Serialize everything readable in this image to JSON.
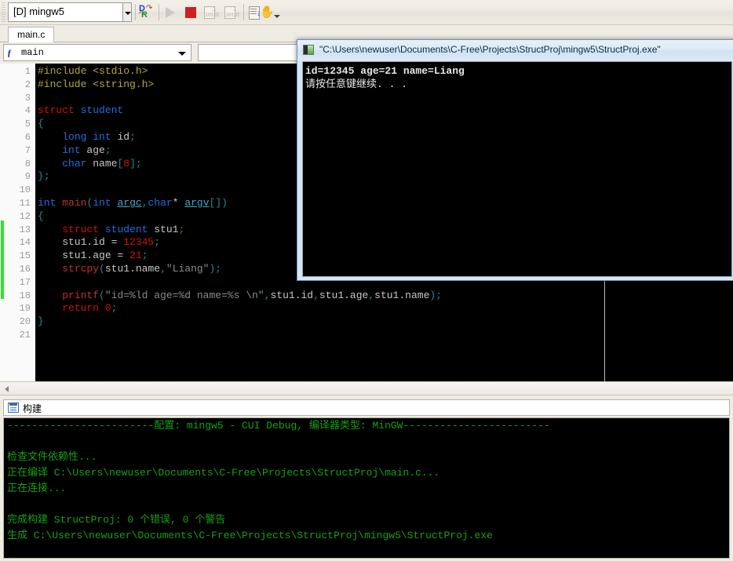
{
  "toolbar": {
    "target_combo_value": "[D] mingw5",
    "buttons": [
      {
        "name": "debug-release-toggle",
        "icon": "debug-release-icon",
        "label": "Debug/Release"
      },
      {
        "name": "run-button",
        "icon": "play-icon",
        "label": "Run"
      },
      {
        "name": "stop-button",
        "icon": "stop-icon",
        "label": "Stop"
      },
      {
        "name": "step-into-button",
        "icon": "step-into-icon",
        "label": "Step Into"
      },
      {
        "name": "step-over-button",
        "icon": "step-over-icon",
        "label": "Step Over"
      },
      {
        "name": "build-log-button",
        "icon": "list-down-icon",
        "label": "Build Log"
      },
      {
        "name": "pause-hand-button",
        "icon": "hand-icon",
        "label": "Hand"
      }
    ],
    "overflow_icon": "chevron-down-icon"
  },
  "tabs": [
    {
      "label": "main.c",
      "active": true
    }
  ],
  "navbar": {
    "function_icon": "function-f-icon",
    "function_value": "main",
    "dropdown_icon": "chevron-down-icon",
    "second_field_value": ""
  },
  "editor": {
    "first_line": 1,
    "last_line": 21,
    "line_numbers": [
      "1",
      "2",
      "3",
      "4",
      "5",
      "6",
      "7",
      "8",
      "9",
      "10",
      "11",
      "12",
      "13",
      "14",
      "15",
      "16",
      "17",
      "18",
      "19",
      "20",
      "21"
    ],
    "lines": [
      {
        "n": 1,
        "tokens": [
          {
            "t": "#include <stdio.h>",
            "c": "k-pre"
          }
        ]
      },
      {
        "n": 2,
        "tokens": [
          {
            "t": "#include <string.h>",
            "c": "k-pre"
          }
        ]
      },
      {
        "n": 3,
        "tokens": []
      },
      {
        "n": 4,
        "tokens": [
          {
            "t": "struct",
            "c": "k-kw"
          },
          {
            "t": " ",
            "c": "k-plain"
          },
          {
            "t": "student",
            "c": "k-type"
          }
        ]
      },
      {
        "n": 5,
        "tokens": [
          {
            "t": "{",
            "c": "k-punc"
          }
        ]
      },
      {
        "n": 6,
        "tokens": [
          {
            "t": "    ",
            "c": "k-plain"
          },
          {
            "t": "long",
            "c": "k-type"
          },
          {
            "t": " ",
            "c": "k-plain"
          },
          {
            "t": "int",
            "c": "k-type"
          },
          {
            "t": " id",
            "c": "k-plain"
          },
          {
            "t": ";",
            "c": "k-punc"
          }
        ]
      },
      {
        "n": 7,
        "tokens": [
          {
            "t": "    ",
            "c": "k-plain"
          },
          {
            "t": "int",
            "c": "k-type"
          },
          {
            "t": " age",
            "c": "k-plain"
          },
          {
            "t": ";",
            "c": "k-punc"
          }
        ]
      },
      {
        "n": 8,
        "tokens": [
          {
            "t": "    ",
            "c": "k-plain"
          },
          {
            "t": "char",
            "c": "k-type"
          },
          {
            "t": " name",
            "c": "k-plain"
          },
          {
            "t": "[",
            "c": "k-punc"
          },
          {
            "t": "8",
            "c": "k-num"
          },
          {
            "t": "]",
            "c": "k-punc"
          },
          {
            "t": ";",
            "c": "k-punc"
          }
        ]
      },
      {
        "n": 9,
        "tokens": [
          {
            "t": "}",
            "c": "k-punc"
          },
          {
            "t": ";",
            "c": "k-punc"
          }
        ]
      },
      {
        "n": 10,
        "tokens": []
      },
      {
        "n": 11,
        "tokens": [
          {
            "t": "int",
            "c": "k-type"
          },
          {
            "t": " ",
            "c": "k-plain"
          },
          {
            "t": "main",
            "c": "k-fn"
          },
          {
            "t": "(",
            "c": "k-punc"
          },
          {
            "t": "int",
            "c": "k-type"
          },
          {
            "t": " ",
            "c": "k-plain"
          },
          {
            "t": "argc",
            "c": "k-id k-ul"
          },
          {
            "t": ",",
            "c": "k-punc"
          },
          {
            "t": "char",
            "c": "k-type"
          },
          {
            "t": "* ",
            "c": "k-plain"
          },
          {
            "t": "argv",
            "c": "k-id k-ul"
          },
          {
            "t": "[]",
            "c": "k-punc"
          },
          {
            "t": ")",
            "c": "k-punc"
          }
        ]
      },
      {
        "n": 12,
        "tokens": [
          {
            "t": "{",
            "c": "k-punc"
          }
        ]
      },
      {
        "n": 13,
        "tokens": [
          {
            "t": "    ",
            "c": "k-plain"
          },
          {
            "t": "struct",
            "c": "k-kw"
          },
          {
            "t": " ",
            "c": "k-plain"
          },
          {
            "t": "student",
            "c": "k-type"
          },
          {
            "t": " stu1",
            "c": "k-plain"
          },
          {
            "t": ";",
            "c": "k-punc"
          }
        ]
      },
      {
        "n": 14,
        "tokens": [
          {
            "t": "    stu1.id = ",
            "c": "k-plain"
          },
          {
            "t": "12345",
            "c": "k-num"
          },
          {
            "t": ";",
            "c": "k-punc"
          }
        ]
      },
      {
        "n": 15,
        "tokens": [
          {
            "t": "    stu1.age = ",
            "c": "k-plain"
          },
          {
            "t": "21",
            "c": "k-num"
          },
          {
            "t": ";",
            "c": "k-punc"
          }
        ]
      },
      {
        "n": 16,
        "tokens": [
          {
            "t": "    ",
            "c": "k-plain"
          },
          {
            "t": "strcpy",
            "c": "k-fn"
          },
          {
            "t": "(",
            "c": "k-punc"
          },
          {
            "t": "stu1.name",
            "c": "k-plain"
          },
          {
            "t": ",",
            "c": "k-punc"
          },
          {
            "t": "\"Liang\"",
            "c": "k-str"
          },
          {
            "t": ")",
            "c": "k-punc"
          },
          {
            "t": ";",
            "c": "k-punc"
          }
        ]
      },
      {
        "n": 17,
        "tokens": []
      },
      {
        "n": 18,
        "tokens": [
          {
            "t": "    ",
            "c": "k-plain"
          },
          {
            "t": "printf",
            "c": "k-fn"
          },
          {
            "t": "(",
            "c": "k-punc"
          },
          {
            "t": "\"id=%ld age=%d name=%s \\n\"",
            "c": "k-str"
          },
          {
            "t": ",",
            "c": "k-punc"
          },
          {
            "t": "stu1.id",
            "c": "k-plain"
          },
          {
            "t": ",",
            "c": "k-punc"
          },
          {
            "t": "stu1.age",
            "c": "k-plain"
          },
          {
            "t": ",",
            "c": "k-punc"
          },
          {
            "t": "stu1.name",
            "c": "k-plain"
          },
          {
            "t": ")",
            "c": "k-punc"
          },
          {
            "t": ";",
            "c": "k-punc"
          }
        ]
      },
      {
        "n": 19,
        "tokens": [
          {
            "t": "    ",
            "c": "k-plain"
          },
          {
            "t": "return",
            "c": "k-kw"
          },
          {
            "t": " ",
            "c": "k-plain"
          },
          {
            "t": "0",
            "c": "k-num"
          },
          {
            "t": ";",
            "c": "k-punc"
          }
        ]
      },
      {
        "n": 20,
        "tokens": [
          {
            "t": "}",
            "c": "k-punc"
          }
        ]
      },
      {
        "n": 21,
        "tokens": []
      }
    ],
    "modified_marker_color": "#33e033",
    "background_color": "#000000"
  },
  "console_window": {
    "title": "\"C:\\Users\\newuser\\Documents\\C-Free\\Projects\\StructProj\\mingw5\\StructProj.exe\"",
    "icon": "console-window-icon",
    "output_lines": [
      "id=12345 age=21 name=Liang",
      "请按任意键继续. . ."
    ]
  },
  "build_panel": {
    "header_icon": "build-panel-icon",
    "header_label": "构建",
    "output_lines": [
      "------------------------配置: mingw5 - CUI Debug, 编译器类型: MinGW------------------------",
      "",
      "检查文件依赖性...",
      "正在编译 C:\\Users\\newuser\\Documents\\C-Free\\Projects\\StructProj\\main.c...",
      "正在连接...",
      "",
      "完成构建 StructProj: 0 个错误, 0 个警告",
      "生成 C:\\Users\\newuser\\Documents\\C-Free\\Projects\\StructProj\\mingw5\\StructProj.exe"
    ],
    "text_color": "#17a017",
    "background_color": "#000000"
  },
  "colors": {
    "chrome": "#efece4",
    "editor_bg": "#000000",
    "console_bg": "#000000",
    "build_text": "#17a017",
    "title_accent": "#6a93bb"
  }
}
